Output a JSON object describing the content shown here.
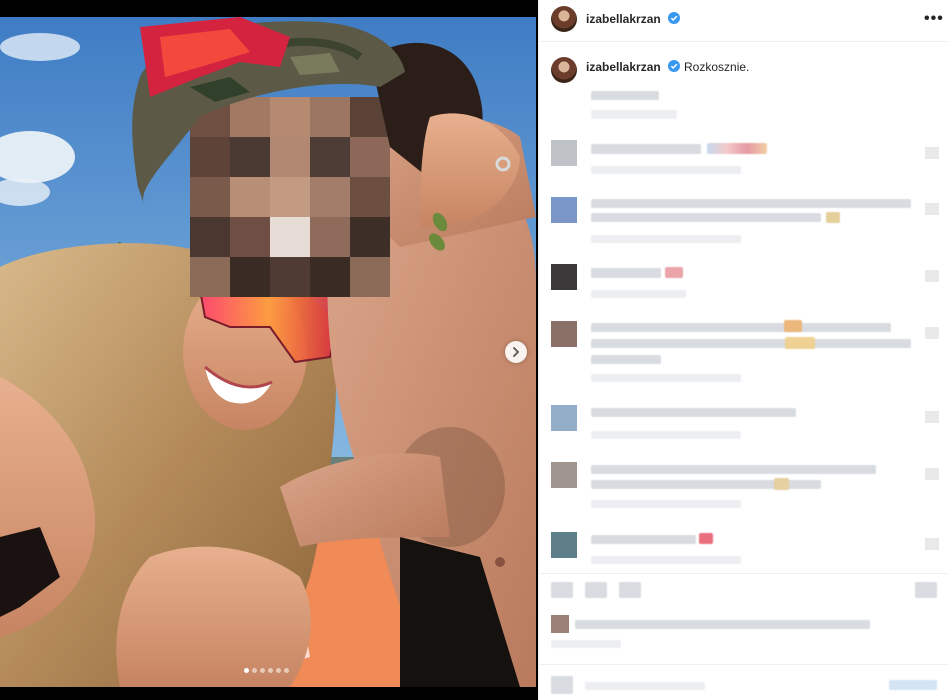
{
  "post": {
    "username": "izabellakrzan",
    "verified": true,
    "more_menu": "•••",
    "caption_username": "izabellakrzan",
    "caption": "Rozkosznie."
  },
  "carousel": {
    "slide_count": 6,
    "active_index": 0,
    "next_icon": "chevron-right-icon"
  },
  "colors": {
    "verified_blue": "#3897f0",
    "text": "#262626",
    "border": "#efefef"
  }
}
